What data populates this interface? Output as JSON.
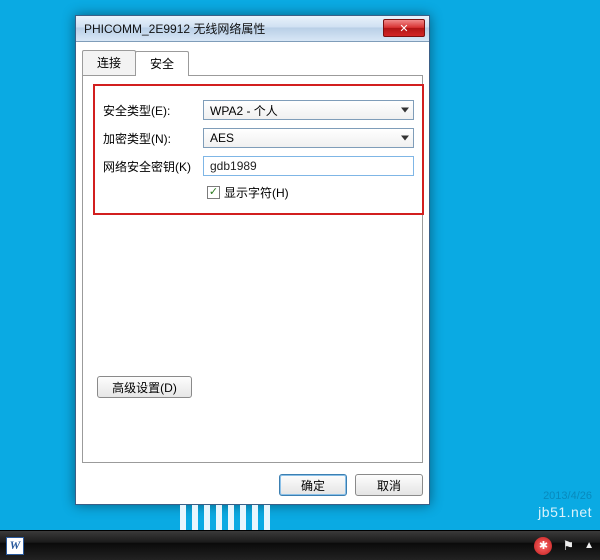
{
  "window": {
    "title": "PHICOMM_2E9912 无线网络属性",
    "close_glyph": "✕"
  },
  "tabs": {
    "connect": "连接",
    "security": "安全"
  },
  "fields": {
    "security_type": {
      "label": "安全类型(E):",
      "value": "WPA2 - 个人"
    },
    "encryption_type": {
      "label": "加密类型(N):",
      "value": "AES"
    },
    "network_key": {
      "label": "网络安全密钥(K)",
      "value": "gdb1989"
    },
    "show_chars": {
      "label": "显示字符(H)",
      "checked": true
    }
  },
  "buttons": {
    "advanced": "高级设置(D)",
    "ok": "确定",
    "cancel": "取消"
  },
  "overlay": {
    "watermark": "jb51.net",
    "faint_date": "2013/4/26"
  },
  "taskbar": {
    "word_glyph": "W",
    "net_glyph": "✱",
    "flag_glyph": "⚑",
    "chev_glyph": "▲"
  }
}
